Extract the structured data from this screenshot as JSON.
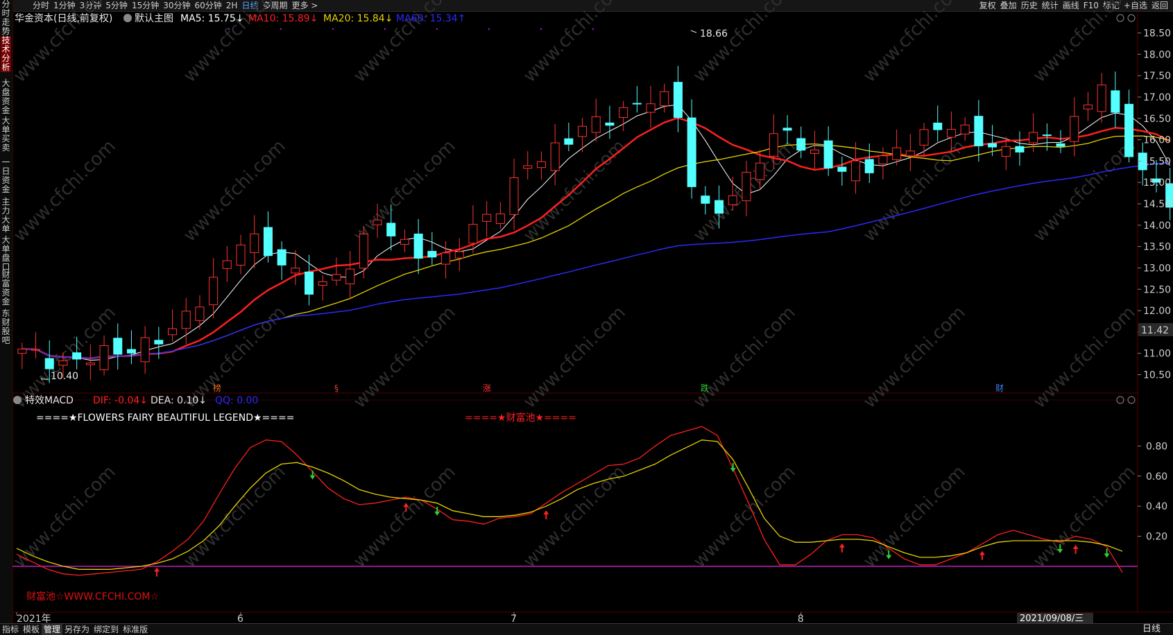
{
  "toolbar": {
    "left": [
      "分时",
      "1分钟",
      "3分钟",
      "5分钟",
      "15分钟",
      "30分钟",
      "60分钟",
      "2H",
      "日线",
      "多周期",
      "更多 >"
    ],
    "right": [
      "复权",
      "叠加",
      "历史",
      "统计",
      "画线",
      "F10",
      "标记",
      "+自选",
      "返回"
    ]
  },
  "sidebar": [
    "分时走势",
    "技术分析",
    "大盘资金",
    "大单买卖",
    "一日资金",
    "主力大单",
    "大单盘口",
    "财富资金",
    "东财股吧"
  ],
  "main_header": {
    "stock": "华金资本(日线,前复权)",
    "template": "默认主图",
    "ma5": "MA5: 15.75↓",
    "ma10": "MA10: 15.89↓",
    "ma20": "MA20: 15.84↓",
    "ma60": "MA60: 15.34↑"
  },
  "sub_header": {
    "name": "特效MACD",
    "dif": "DIF: -0.04↓",
    "dea": "DEA: 0.10↓",
    "qq": "QQ: 0.00"
  },
  "legend_text": "====★FLOWERS FAIRY BEAUTIFUL LEGEND★====",
  "pool_text": "====★财富池★====",
  "watermark_text": "财富池☆WWW.CFCHI.COM☆",
  "watermark": "www.cfchi.com",
  "high_label": "18.66",
  "low_label": "10.40",
  "current_price": "11.42",
  "date_label": "2021/09/08/三",
  "event_markers": [
    {
      "text": "榜",
      "color": "#e07020"
    },
    {
      "text": "§",
      "color": "#e04040"
    },
    {
      "text": "涨",
      "color": "#ff3030"
    },
    {
      "text": "跌",
      "color": "#30d030"
    },
    {
      "text": "财",
      "color": "#4080ff"
    }
  ],
  "bottom_tabs": [
    "指标",
    "模板",
    "管理",
    "另存为",
    "绑定到",
    "标准版"
  ],
  "period": "日线",
  "colors": {
    "up": "#ff3232",
    "down": "#54ffff",
    "ma5": "#ffffff",
    "ma10": "#ff2020",
    "ma20": "#e8d400",
    "ma60": "#2a2aff",
    "zero": "#c020c0"
  },
  "chart_data": [
    {
      "type": "candlestick",
      "title": "华金资本(日线,前复权)",
      "y_ticks": [
        18.5,
        18.0,
        17.5,
        17.0,
        16.5,
        16.0,
        15.5,
        15.0,
        14.5,
        14.0,
        13.5,
        13.0,
        12.5,
        12.0,
        11.5,
        11.0,
        10.5
      ],
      "ylim": [
        10.07,
        18.98
      ],
      "x_month_labels": [
        "2021年",
        "6",
        "7",
        "8"
      ],
      "x_month_index": [
        0,
        16,
        36,
        57
      ],
      "count": 85,
      "high": 18.66,
      "low": 10.4,
      "ma_last": {
        "MA5": 15.75,
        "MA10": 15.89,
        "MA20": 15.84,
        "MA60": 15.34
      }
    },
    {
      "type": "line",
      "title": "特效MACD",
      "y_ticks": [
        0.8,
        0.6,
        0.4,
        0.2
      ],
      "ylim": [
        -0.3,
        1.0
      ],
      "zero_line": 0.0,
      "series": [
        {
          "name": "DIF",
          "values": [
            0.08,
            0.03,
            -0.02,
            -0.05,
            -0.06,
            -0.05,
            -0.04,
            -0.03,
            -0.02,
            0.03,
            0.1,
            0.18,
            0.3,
            0.48,
            0.65,
            0.79,
            0.84,
            0.83,
            0.74,
            0.63,
            0.52,
            0.45,
            0.41,
            0.42,
            0.44,
            0.46,
            0.44,
            0.38,
            0.31,
            0.3,
            0.28,
            0.32,
            0.33,
            0.35,
            0.42,
            0.49,
            0.55,
            0.61,
            0.67,
            0.68,
            0.72,
            0.8,
            0.87,
            0.9,
            0.93,
            0.87,
            0.65,
            0.42,
            0.18,
            0.01,
            0.01,
            0.08,
            0.17,
            0.21,
            0.21,
            0.19,
            0.12,
            0.05,
            0.01,
            0.01,
            0.05,
            0.09,
            0.15,
            0.21,
            0.24,
            0.21,
            0.18,
            0.16,
            0.2,
            0.18,
            0.13,
            -0.04
          ]
        },
        {
          "name": "DEA",
          "values": [
            0.12,
            0.07,
            0.03,
            0.0,
            -0.02,
            -0.02,
            -0.02,
            -0.01,
            0.0,
            0.02,
            0.05,
            0.1,
            0.17,
            0.27,
            0.4,
            0.52,
            0.62,
            0.68,
            0.69,
            0.66,
            0.62,
            0.57,
            0.51,
            0.48,
            0.46,
            0.45,
            0.44,
            0.42,
            0.37,
            0.35,
            0.33,
            0.33,
            0.34,
            0.36,
            0.4,
            0.45,
            0.51,
            0.55,
            0.58,
            0.6,
            0.64,
            0.68,
            0.74,
            0.79,
            0.84,
            0.83,
            0.71,
            0.52,
            0.32,
            0.2,
            0.16,
            0.16,
            0.17,
            0.18,
            0.18,
            0.17,
            0.13,
            0.09,
            0.06,
            0.06,
            0.07,
            0.09,
            0.13,
            0.16,
            0.17,
            0.17,
            0.17,
            0.17,
            0.17,
            0.16,
            0.14,
            0.1
          ]
        }
      ]
    }
  ]
}
